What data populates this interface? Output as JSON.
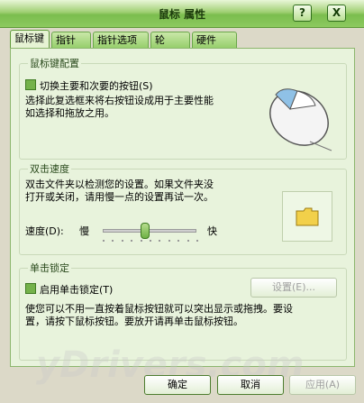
{
  "window": {
    "title": "鼠标 属性",
    "help_glyph": "?",
    "close_glyph": "X"
  },
  "tabs": [
    {
      "label": "鼠标键",
      "active": true
    },
    {
      "label": "指针",
      "active": false
    },
    {
      "label": "指针选项",
      "active": false
    },
    {
      "label": "轮",
      "active": false
    },
    {
      "label": "硬件",
      "active": false
    }
  ],
  "buttons_group": {
    "title": "鼠标键配置",
    "checkbox_label": "切换主要和次要的按钮(S)",
    "description": "选择此复选框来将右按钮设成用于主要性能\n如选择和拖放之用。",
    "icon": "mouse-icon"
  },
  "double_click": {
    "title": "双击速度",
    "description": "双击文件夹以检测您的设置。如果文件夹没\n打开或关闭，请用慢一点的设置再试一次。",
    "speed_label": "速度(D):",
    "slow_label": "慢",
    "fast_label": "快",
    "slider_value": 0.45,
    "folder_icon": "folder-icon",
    "folder_color": "#f2d04a"
  },
  "click_lock": {
    "title": "单击锁定",
    "checkbox_label": "启用单击锁定(T)",
    "settings_button": "设置(E)...",
    "description": "使您可以不用一直按着鼠标按钮就可以突出显示或拖拽。要设\n置，请按下鼠标按钮。要放开请再单击鼠标按钮。"
  },
  "footer": {
    "ok": "确定",
    "cancel": "取消",
    "apply": "应用(A)"
  },
  "watermark": "yDrivers.com",
  "colors": {
    "accent": "#74b24a",
    "titlebar": "#8cc95f"
  }
}
